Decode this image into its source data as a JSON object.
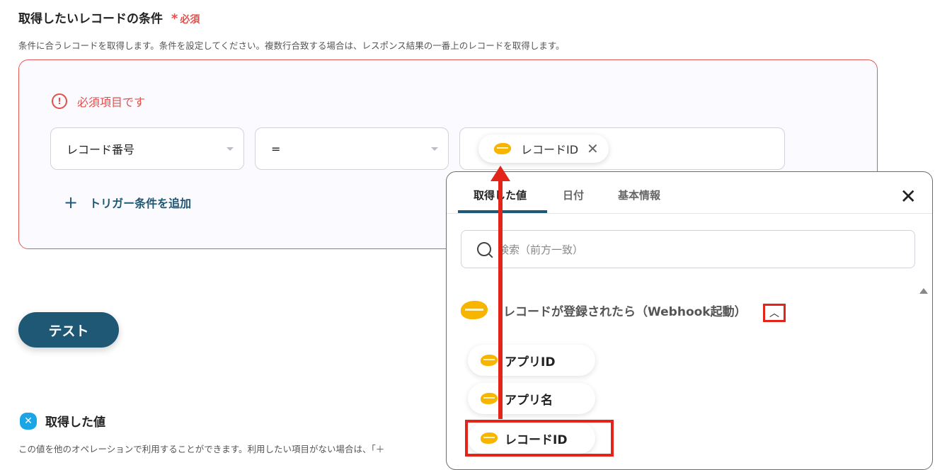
{
  "header": {
    "title": "取得したいレコードの条件",
    "required_mark": "*",
    "required_label": "必須",
    "description": "条件に合うレコードを取得します。条件を設定してください。複数行合致する場合は、レスポンス結果の一番上のレコードを取得します。"
  },
  "condition": {
    "error_text": "必須項目です",
    "field_select": "レコード番号",
    "operator_select": "=",
    "value_chip": "レコードID",
    "add_trigger_label": "トリガー条件を追加"
  },
  "test_button": "テスト",
  "acquired": {
    "title": "取得した値",
    "description": "この値を他のオペレーションで利用することができます。利用したい項目がない場合は、「＋"
  },
  "panel": {
    "tabs": [
      {
        "label": "取得した値"
      },
      {
        "label": "日付"
      },
      {
        "label": "基本情報"
      }
    ],
    "search_placeholder": "検索（前方一致）",
    "group_title": "レコードが登録されたら（Webhook起動）",
    "items": [
      {
        "label": "アプリID"
      },
      {
        "label": "アプリ名"
      },
      {
        "label": "レコードID"
      }
    ]
  },
  "colors": {
    "accent": "#1f5875",
    "error": "#e2504c",
    "annotation": "#e3241b",
    "kintone": "#f7b500"
  },
  "icons": {
    "error": "alert-circle-icon",
    "search": "search-icon",
    "close": "close-icon",
    "app": "kintone-icon",
    "plus": "plus-icon",
    "collapse": "chevron-up-icon"
  }
}
